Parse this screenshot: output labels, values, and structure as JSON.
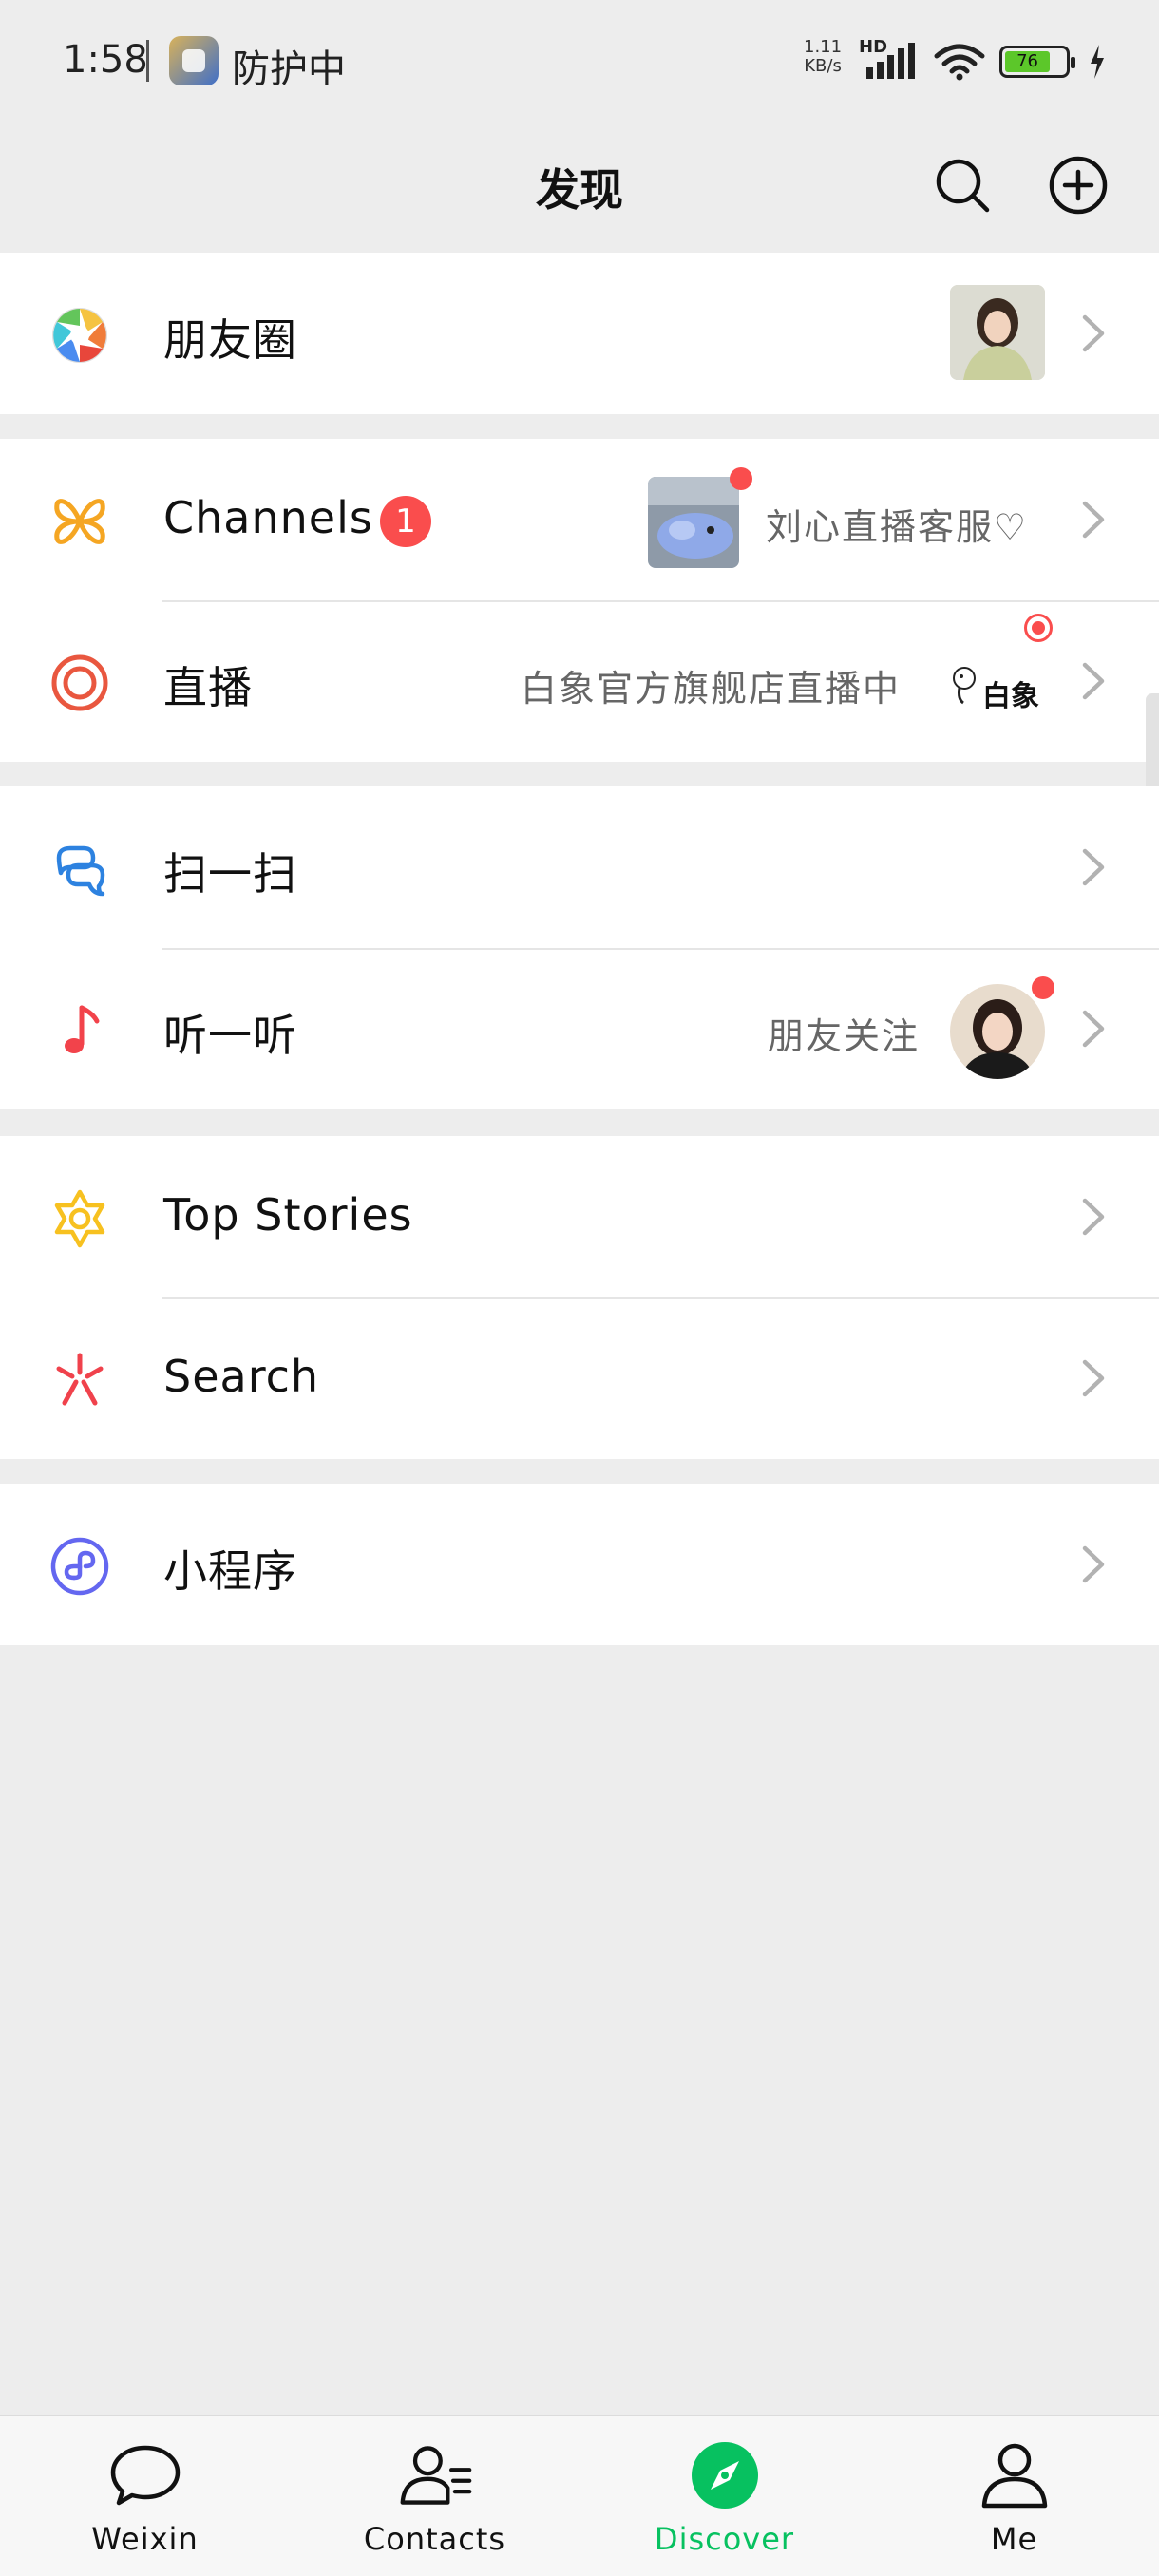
{
  "status_bar": {
    "time": "1:58",
    "protect_text": "防护中",
    "net_speed_value": "1.11",
    "net_speed_unit": "KB/s",
    "network_type": "HD",
    "battery_level": "76"
  },
  "header": {
    "title": "发现"
  },
  "groups": {
    "moments": {
      "label": "朋友圈"
    },
    "channels": {
      "label": "Channels",
      "badge": "1",
      "subtitle": "刘心直播客服♡"
    },
    "live": {
      "label": "直播",
      "subtitle": "白象官方旗舰店直播中",
      "logo_text": "白象"
    },
    "scan": {
      "label": "扫一扫"
    },
    "listen": {
      "label": "听一听",
      "subtitle": "朋友关注"
    },
    "top_stories": {
      "label": "Top Stories"
    },
    "search": {
      "label": "Search"
    },
    "mini_programs": {
      "label": "小程序"
    }
  },
  "tabbar": {
    "weixin": "Weixin",
    "contacts": "Contacts",
    "discover": "Discover",
    "me": "Me"
  },
  "colors": {
    "accent_green": "#07c160",
    "badge_red": "#fa4d4d",
    "channels_orange": "#f5a623",
    "live_red": "#e9573f",
    "scan_blue": "#2d82e0",
    "listen_red": "#f2434b",
    "stories_yellow": "#f7c120",
    "search_red": "#f0424c",
    "mini_purple": "#6467f0"
  },
  "icons": {
    "moments": "camera-aperture-icon",
    "channels": "butterfly-icon",
    "live": "target-icon",
    "scan": "scan-icon",
    "listen": "music-note-icon",
    "top_stories": "star-flower-icon",
    "search": "spark-icon",
    "mini_programs": "mini-program-icon"
  }
}
